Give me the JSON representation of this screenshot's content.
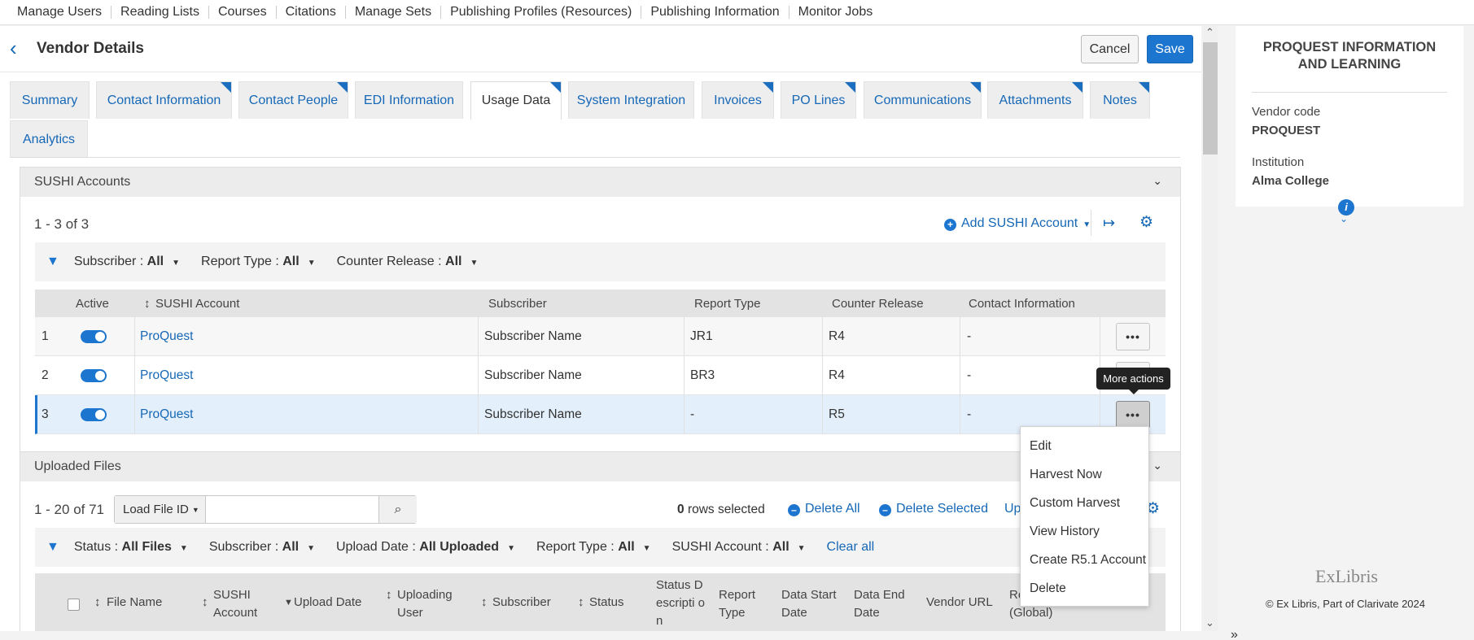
{
  "top_menu": [
    "Manage Users",
    "Reading Lists",
    "Courses",
    "Citations",
    "Manage Sets",
    "Publishing Profiles (Resources)",
    "Publishing Information",
    "Monitor Jobs"
  ],
  "header": {
    "title": "Vendor Details",
    "cancel": "Cancel",
    "save": "Save"
  },
  "tabs": [
    "Summary",
    "Contact Information",
    "Contact People",
    "EDI Information",
    "Usage Data",
    "System Integration",
    "Invoices",
    "PO Lines",
    "Communications",
    "Attachments",
    "Notes",
    "Analytics"
  ],
  "active_tab": "Usage Data",
  "sushi": {
    "section_title": "SUSHI Accounts",
    "count": "1 - 3 of 3",
    "add_button": "Add SUSHI Account",
    "filters": [
      {
        "label": "Subscriber :",
        "value": "All"
      },
      {
        "label": "Report Type :",
        "value": "All"
      },
      {
        "label": "Counter Release :",
        "value": "All"
      }
    ],
    "columns": [
      "Active",
      "SUSHI Account",
      "Subscriber",
      "Report Type",
      "Counter Release",
      "Contact Information"
    ],
    "rows": [
      {
        "num": "1",
        "account": "ProQuest",
        "subscriber": "Subscriber Name",
        "report_type": "JR1",
        "release": "R4",
        "contact": "-"
      },
      {
        "num": "2",
        "account": "ProQuest",
        "subscriber": "Subscriber Name",
        "report_type": "BR3",
        "release": "R4",
        "contact": "-"
      },
      {
        "num": "3",
        "account": "ProQuest",
        "subscriber": "Subscriber Name",
        "report_type": "-",
        "release": "R5",
        "contact": "-"
      }
    ],
    "more_glyph": "•••"
  },
  "tooltip": "More actions",
  "context_menu": [
    "Edit",
    "Harvest Now",
    "Custom Harvest",
    "View History",
    "Create R5.1 Account",
    "Delete"
  ],
  "uploaded": {
    "section_title": "Uploaded Files",
    "count": "1 - 20 of 71",
    "load_select": "Load File ID",
    "rows_selected_num": "0",
    "rows_selected_text": "rows selected",
    "delete_all": "Delete All",
    "delete_selected": "Delete Selected",
    "upload_partial": "Upl",
    "filters": [
      {
        "label": "Status :",
        "value": "All Files"
      },
      {
        "label": "Subscriber :",
        "value": "All"
      },
      {
        "label": "Upload Date :",
        "value": "All Uploaded"
      },
      {
        "label": "Report Type :",
        "value": "All"
      },
      {
        "label": "SUSHI Account :",
        "value": "All"
      }
    ],
    "clear_all": "Clear all",
    "columns": {
      "file_name": "File Name",
      "sushi_account": "SUSHI Account",
      "upload_date": "Upload Date",
      "uploading_user": "Uploading User",
      "subscriber": "Subscriber",
      "status": "Status",
      "status_description": "Status Descripti on",
      "report_type": "Report Type",
      "data_start": "Data Start Date",
      "data_end": "Data End Date",
      "vendor_url": "Vendor URL",
      "rate": "Re Rate (Global)"
    }
  },
  "side_panel": {
    "title": "PROQUEST INFORMATION AND LEARNING",
    "vendor_code_label": "Vendor code",
    "vendor_code": "PROQUEST",
    "institution_label": "Institution",
    "institution": "Alma College",
    "logo": "ExLibris",
    "footer": "© Ex Libris, Part of Clarivate   2024"
  },
  "colors": {
    "accent": "#1c75cf",
    "link": "#1668b7",
    "selected_row": "#e3effb"
  }
}
